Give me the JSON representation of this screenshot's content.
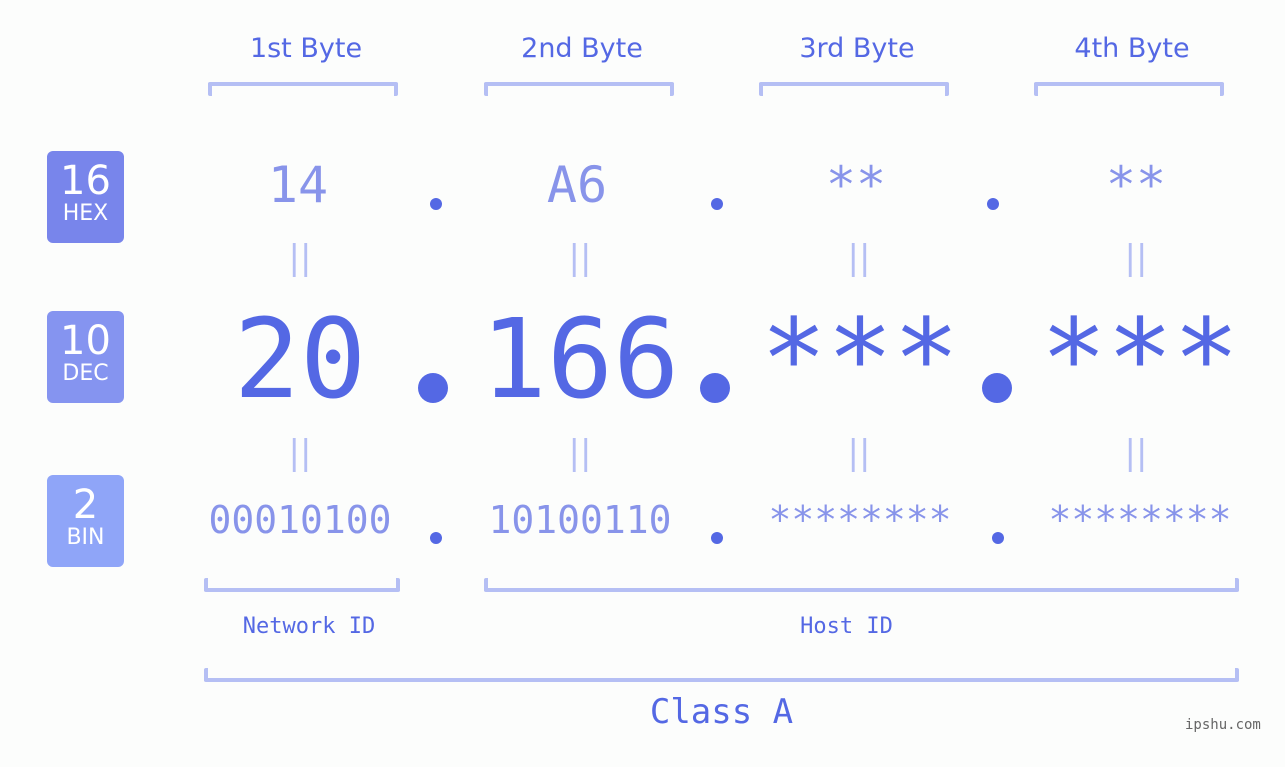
{
  "headers": [
    "1st Byte",
    "2nd Byte",
    "3rd Byte",
    "4th Byte"
  ],
  "rows": {
    "hex": {
      "base": "16",
      "label": "HEX",
      "values": [
        "14",
        "A6",
        "**",
        "**"
      ],
      "color": "#7885eb"
    },
    "dec": {
      "base": "10",
      "label": "DEC",
      "values": [
        "20",
        "166",
        "***",
        "***"
      ],
      "color": "#8594f0"
    },
    "bin": {
      "base": "2",
      "label": "BIN",
      "values": [
        "00010100",
        "10100110",
        "********",
        "********"
      ],
      "color": "#8fa5f8"
    }
  },
  "equals_sign": "||",
  "segments": {
    "network": "Network ID",
    "host": "Host ID"
  },
  "class_label": "Class A",
  "watermark": "ipshu.com",
  "colors": {
    "accent": "#5468e4",
    "light": "#8894ea",
    "bracket": "#b5bff4"
  }
}
